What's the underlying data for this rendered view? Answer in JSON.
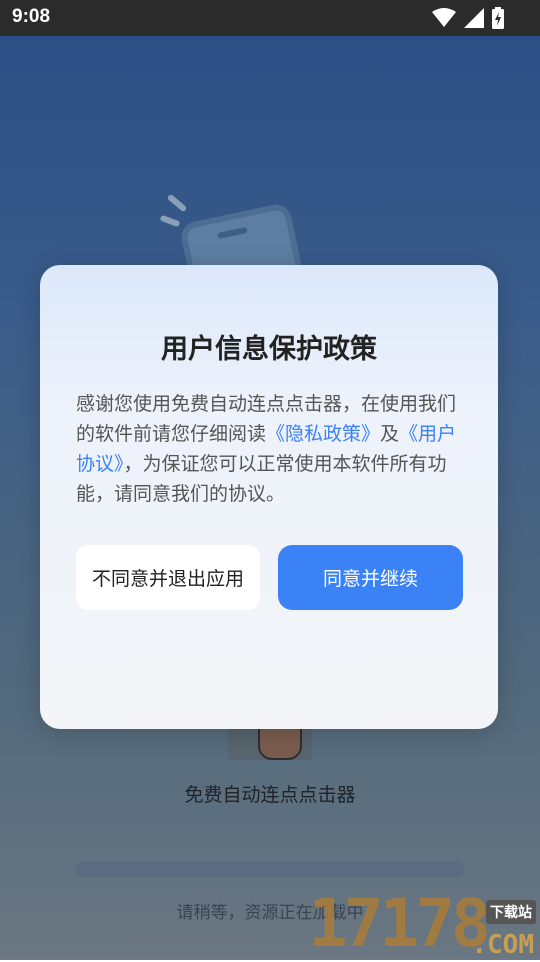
{
  "status_bar": {
    "time": "9:08",
    "icons": [
      "wifi-icon",
      "cell-signal-icon",
      "battery-charging-icon"
    ]
  },
  "background_app": {
    "app_name": "免费自动连点点击器",
    "loading_text": "请稍等，资源正在加载中",
    "progress": 0
  },
  "dialog": {
    "title": "用户信息保护政策",
    "body_part1": "感谢您使用免费自动连点点击器，在使用我们的软件前请您仔细阅读",
    "privacy_link": "《隐私政策》",
    "body_and": "及",
    "user_link": "《用户协议》",
    "body_part2": "，为保证您可以正常使用本软件所有功能，请同意我们的协议。",
    "decline_label": "不同意并退出应用",
    "accept_label": "同意并继续"
  },
  "watermark": {
    "number": "17178",
    "domain": ".COM",
    "site_label": "下载站"
  },
  "colors": {
    "accent": "#3b82f6",
    "link": "#3c82f6",
    "status_bar_bg": "#2b2b2b"
  }
}
